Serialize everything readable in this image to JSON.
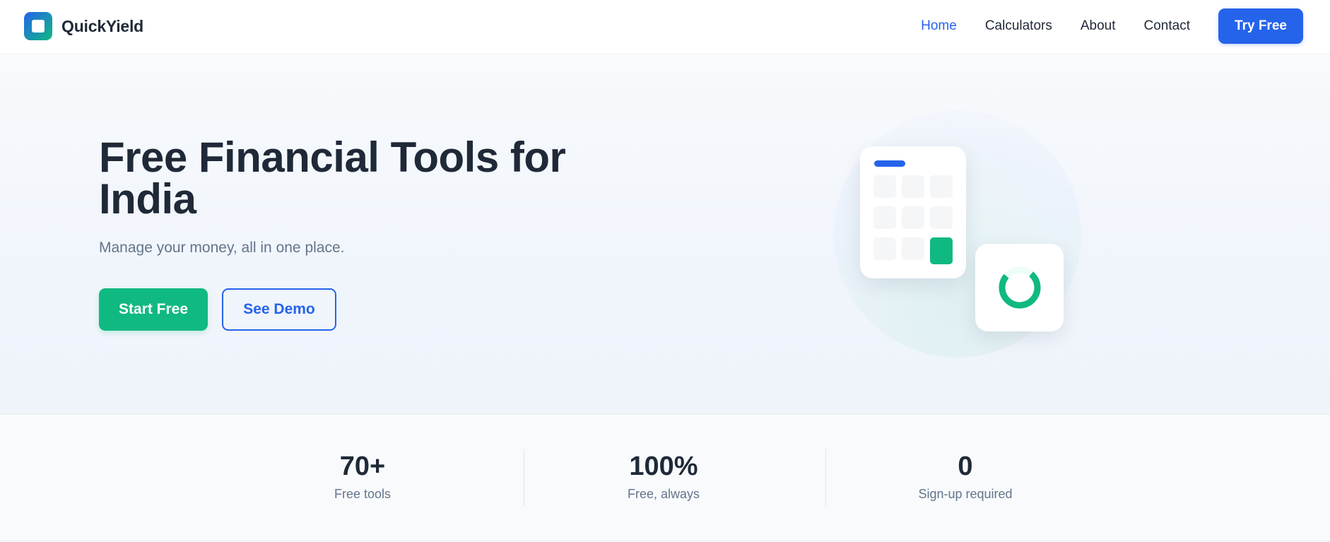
{
  "brand": {
    "name": "QuickYield",
    "logo_icon": "square-logo-icon"
  },
  "nav": {
    "links": [
      "Home",
      "Calculators",
      "About",
      "Contact"
    ],
    "active": "Home",
    "cta": "Try Free"
  },
  "hero": {
    "title": "Free Financial Tools for India",
    "subtitle": "Manage your money, all in one place.",
    "primary_cta": "Start Free",
    "secondary_cta": "See Demo",
    "illustration_icons": [
      "calculator-icon",
      "donut-chart-icon"
    ]
  },
  "stats": [
    {
      "value": "70+",
      "label": "Free tools"
    },
    {
      "value": "100%",
      "label": "Free, always"
    },
    {
      "value": "0",
      "label": "Sign-up required"
    }
  ],
  "colors": {
    "primary": "#2563eb",
    "accent": "#10b981",
    "text": "#1f2937",
    "muted": "#64748b"
  }
}
